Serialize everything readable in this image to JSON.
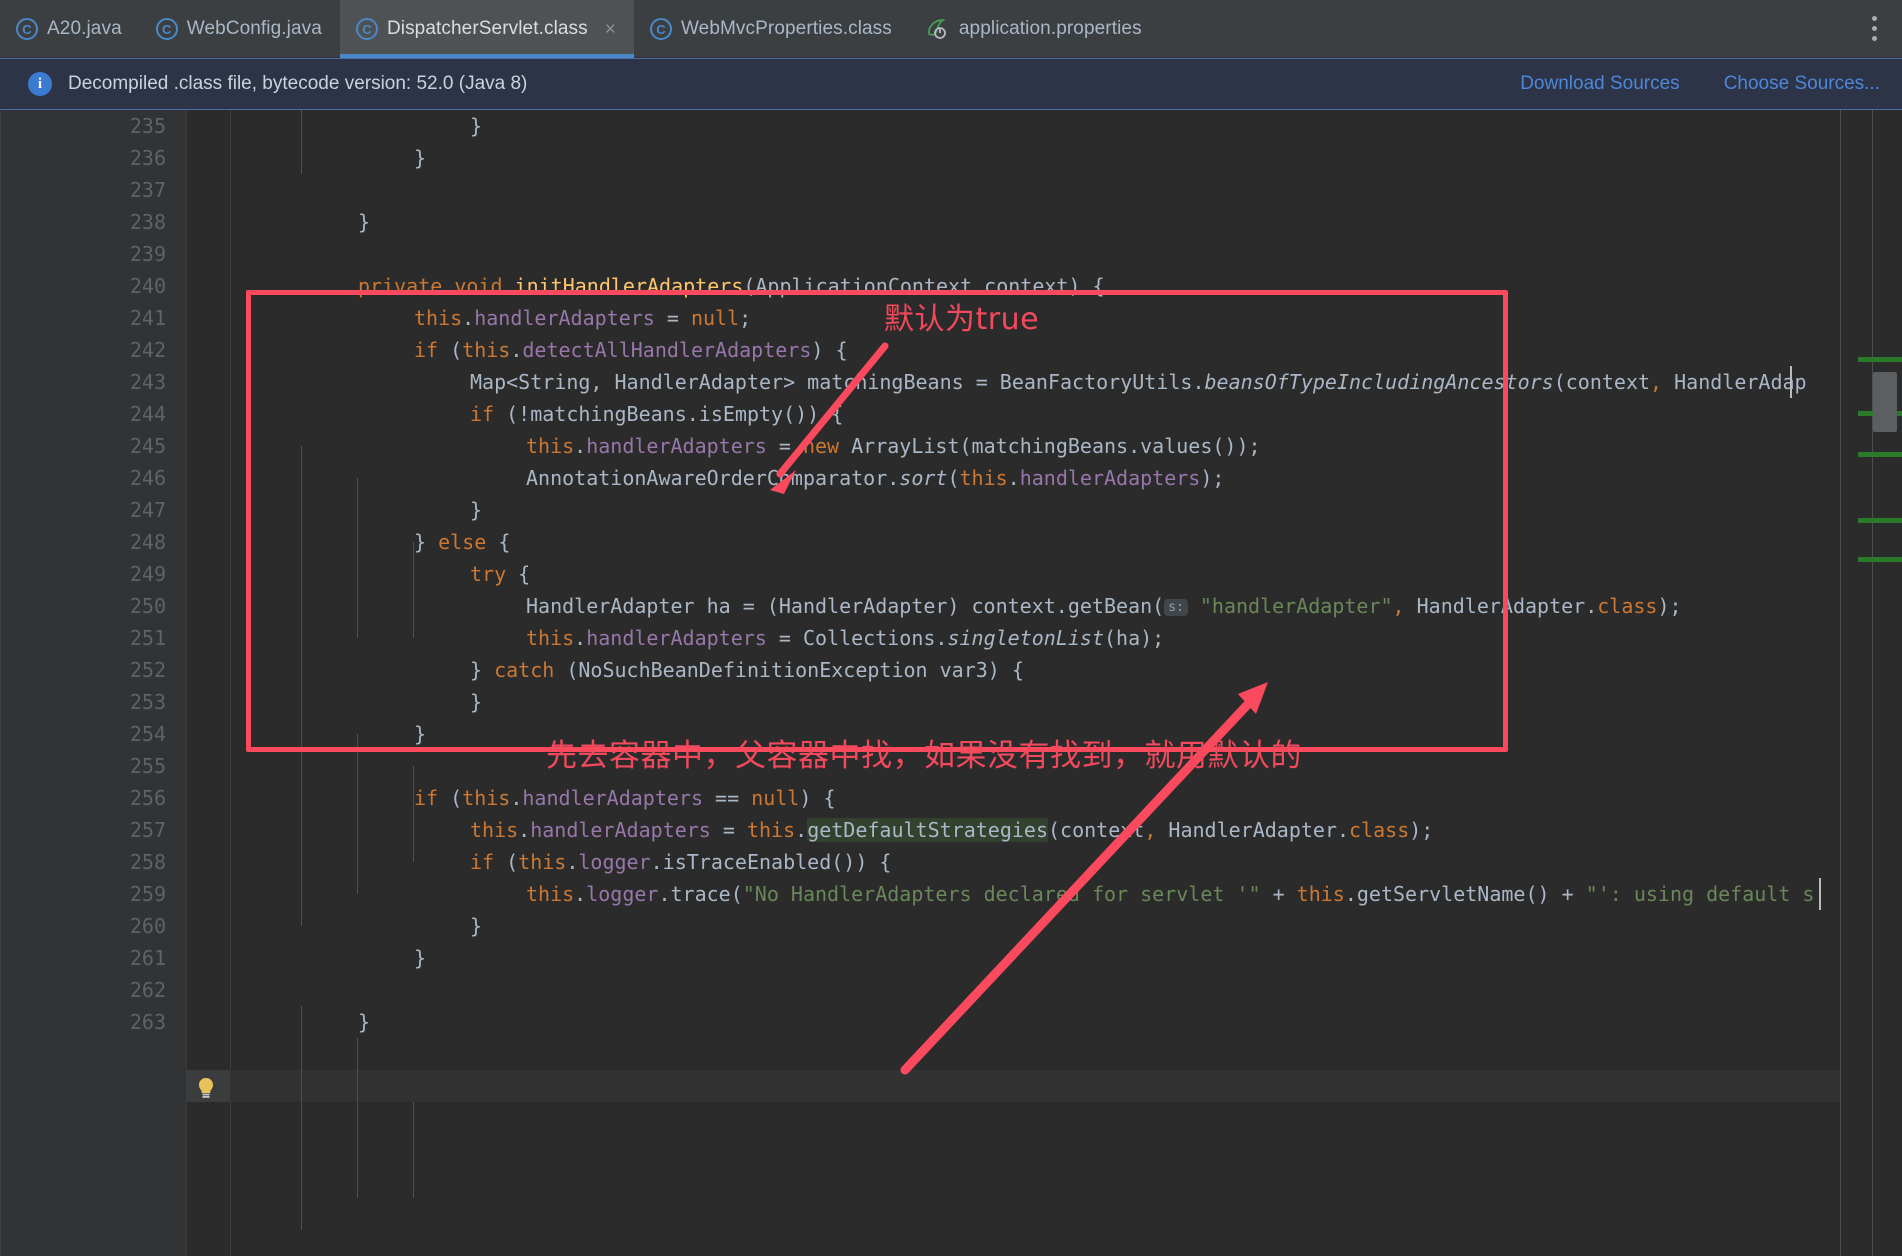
{
  "window": {
    "tabs": [
      {
        "label": "A20.java",
        "icon": "java-class-icon",
        "active": false,
        "closable": false
      },
      {
        "label": "WebConfig.java",
        "icon": "java-class-icon",
        "active": false,
        "closable": false
      },
      {
        "label": "DispatcherServlet.class",
        "icon": "java-class-icon",
        "active": true,
        "closable": true,
        "close_label": "×"
      },
      {
        "label": "WebMvcProperties.class",
        "icon": "java-class-icon",
        "active": false,
        "closable": false
      },
      {
        "label": "application.properties",
        "icon": "spring-boot-icon",
        "active": false,
        "closable": false
      }
    ],
    "overflow_menu_label": "more-options"
  },
  "notice": {
    "icon": "info-icon",
    "icon_glyph": "i",
    "message": "Decompiled .class file, bytecode version: 52.0 (Java 8)",
    "actions": [
      {
        "label": "Download Sources"
      },
      {
        "label": "Choose Sources..."
      }
    ]
  },
  "editor": {
    "filename": "DispatcherServlet.class",
    "first_line": 235,
    "caret_line": 257,
    "gutter_icon": "intention-bulb-icon",
    "lines": [
      {
        "n": 235,
        "indent": 4,
        "text": "}"
      },
      {
        "n": 236,
        "indent": 3,
        "text": "}"
      },
      {
        "n": 237,
        "indent": 0,
        "text": ""
      },
      {
        "n": 238,
        "indent": 2,
        "text": "}"
      },
      {
        "n": 239,
        "indent": 0,
        "text": ""
      },
      {
        "n": 240,
        "indent": 2,
        "text": "private void initHandlerAdapters(ApplicationContext context) {"
      },
      {
        "n": 241,
        "indent": 3,
        "text": "this.handlerAdapters = null;"
      },
      {
        "n": 242,
        "indent": 3,
        "text": "if (this.detectAllHandlerAdapters) {"
      },
      {
        "n": 243,
        "indent": 4,
        "text": "Map<String, HandlerAdapter> matchingBeans = BeanFactoryUtils.beansOfTypeIncludingAncestors(context, HandlerAdap"
      },
      {
        "n": 244,
        "indent": 4,
        "text": "if (!matchingBeans.isEmpty()) {"
      },
      {
        "n": 245,
        "indent": 5,
        "text": "this.handlerAdapters = new ArrayList(matchingBeans.values());"
      },
      {
        "n": 246,
        "indent": 5,
        "text": "AnnotationAwareOrderComparator.sort(this.handlerAdapters);"
      },
      {
        "n": 247,
        "indent": 4,
        "text": "}"
      },
      {
        "n": 248,
        "indent": 3,
        "text": "} else {"
      },
      {
        "n": 249,
        "indent": 4,
        "text": "try {"
      },
      {
        "n": 250,
        "indent": 5,
        "text": "HandlerAdapter ha = (HandlerAdapter) context.getBean( s: \"handlerAdapter\", HandlerAdapter.class);"
      },
      {
        "n": 251,
        "indent": 5,
        "text": "this.handlerAdapters = Collections.singletonList(ha);"
      },
      {
        "n": 252,
        "indent": 4,
        "text": "} catch (NoSuchBeanDefinitionException var3) {"
      },
      {
        "n": 253,
        "indent": 4,
        "text": "}"
      },
      {
        "n": 254,
        "indent": 3,
        "text": "}"
      },
      {
        "n": 255,
        "indent": 0,
        "text": ""
      },
      {
        "n": 256,
        "indent": 3,
        "text": "if (this.handlerAdapters == null) {"
      },
      {
        "n": 257,
        "indent": 4,
        "text": "this.handlerAdapters = this.getDefaultStrategies(context, HandlerAdapter.class);"
      },
      {
        "n": 258,
        "indent": 4,
        "text": "if (this.logger.isTraceEnabled()) {"
      },
      {
        "n": 259,
        "indent": 5,
        "text": "this.logger.trace(\"No HandlerAdapters declared for servlet '\" + this.getServletName() + \"': using default s"
      },
      {
        "n": 260,
        "indent": 4,
        "text": "}"
      },
      {
        "n": 261,
        "indent": 3,
        "text": "}"
      },
      {
        "n": 262,
        "indent": 0,
        "text": ""
      },
      {
        "n": 263,
        "indent": 2,
        "text": "}"
      }
    ],
    "parameter_hint": "s:",
    "highlighted_token": "getDefaultStrategies"
  },
  "annotations": [
    {
      "id": "annot-true",
      "text": "默认为true",
      "color": "#f2495c"
    },
    {
      "id": "annot-container",
      "text": "先去容器中，父容器中找，如果没有找到，就用默认的",
      "color": "#f2495c"
    }
  ],
  "colors": {
    "accent": "#4a88c7",
    "annotation_red": "#fb4a5e",
    "editor_bg": "#2b2b2b",
    "gutter_bg": "#313335",
    "tab_active_bg": "#4e5254",
    "notice_bg": "#2d3447",
    "link": "#4d87d8"
  }
}
